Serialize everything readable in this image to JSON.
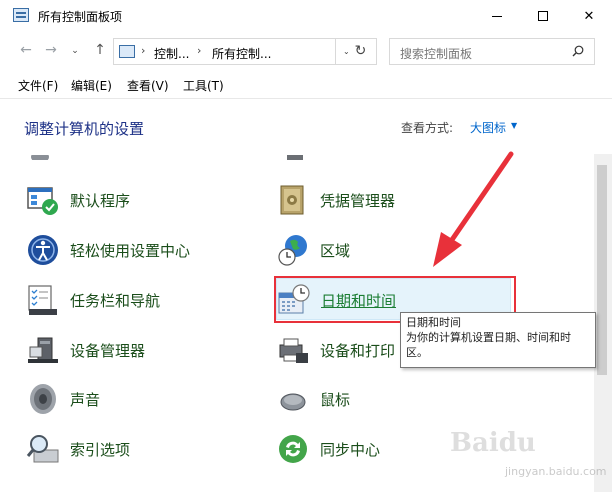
{
  "window": {
    "title": "所有控制面板项",
    "controls": {
      "minimize": "—",
      "maximize": "□",
      "close": "✕"
    }
  },
  "nav": {
    "back": "←",
    "forward": "→",
    "recent": "⌄",
    "up": "↑",
    "breadcrumbs": [
      "控制...",
      "所有控制..."
    ],
    "breadcrumb_sep": "›",
    "refresh": "↻",
    "search_placeholder": "搜索控制面板"
  },
  "menu": [
    "文件(F)",
    "编辑(E)",
    "查看(V)",
    "工具(T)"
  ],
  "content": {
    "heading": "调整计算机的设置",
    "view_by_label": "查看方式:",
    "view_by_value": "大图标"
  },
  "items_left": [
    {
      "label": "默认程序",
      "icon": "default-programs-icon"
    },
    {
      "label": "轻松使用设置中心",
      "icon": "ease-of-access-icon"
    },
    {
      "label": "任务栏和导航",
      "icon": "taskbar-icon"
    },
    {
      "label": "设备管理器",
      "icon": "device-manager-icon"
    },
    {
      "label": "声音",
      "icon": "speaker-icon"
    },
    {
      "label": "索引选项",
      "icon": "indexing-icon"
    }
  ],
  "items_right": [
    {
      "label": "凭据管理器",
      "icon": "credential-manager-icon"
    },
    {
      "label": "区域",
      "icon": "region-globe-icon"
    },
    {
      "label": "日期和时间",
      "icon": "date-time-icon"
    },
    {
      "label": "设备和打印",
      "icon": "printer-icon"
    },
    {
      "label": "鼠标",
      "icon": "mouse-icon"
    },
    {
      "label": "同步中心",
      "icon": "sync-center-icon"
    }
  ],
  "tooltip": {
    "title": "日期和时间",
    "body": "为你的计算机设置日期、时间和时区。"
  },
  "watermark": {
    "text": "Baidu",
    "sub": "jingyan.baidu.com"
  },
  "colors": {
    "heading": "#1e3287",
    "link": "#1b7d33",
    "highlight": "#e8313a"
  }
}
